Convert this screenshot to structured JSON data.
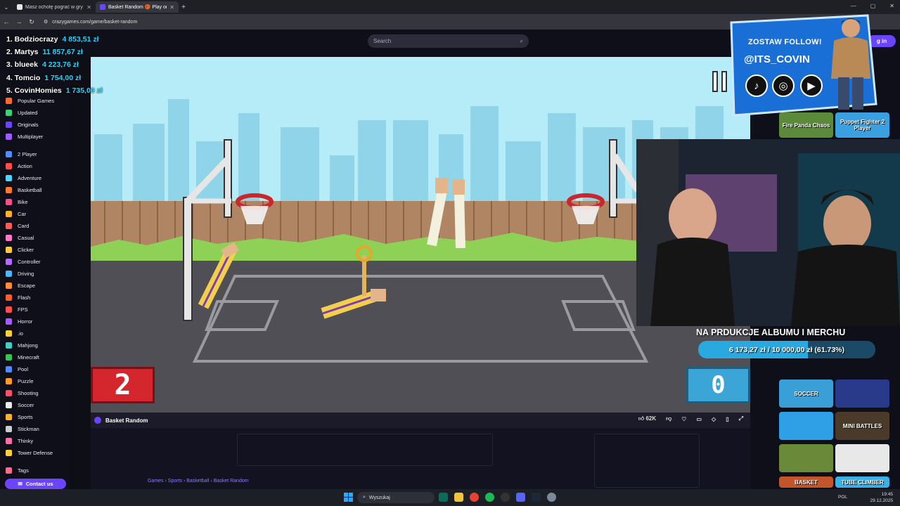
{
  "browser": {
    "tabs": [
      {
        "title": "Masz ochotę pograć w gry Mu..."
      },
      {
        "title": "Basket Random 🏀 Play on..."
      }
    ],
    "url": "crazygames.com/game/basket-random"
  },
  "site": {
    "search_placeholder": "Search",
    "login_label": "g in"
  },
  "leaderboard": [
    {
      "name": "1. Bodziocrazy",
      "amount": "4 853,51 zł"
    },
    {
      "name": "2. Martys",
      "amount": "11 857,67 zł"
    },
    {
      "name": "3. blueek",
      "amount": "4 223,76 zł"
    },
    {
      "name": "4. Tomcio",
      "amount": "1 754,00 zł"
    },
    {
      "name": "5. CovinHomies",
      "amount": "1 735,00 zł"
    }
  ],
  "sidebar": {
    "items": [
      {
        "label": "Popular Games",
        "color": "#ff6a2b"
      },
      {
        "label": "Updated",
        "color": "#3ad17a"
      },
      {
        "label": "Originals",
        "color": "#6b44ff"
      },
      {
        "label": "Multiplayer",
        "color": "#a15cff"
      },
      {
        "label": "2 Player",
        "color": "#4f8cff"
      },
      {
        "label": "Action",
        "color": "#ff4d4d"
      },
      {
        "label": "Adventure",
        "color": "#4fd3ff"
      },
      {
        "label": "Basketball",
        "color": "#ff7b2b"
      },
      {
        "label": "Bike",
        "color": "#ff4d88"
      },
      {
        "label": "Car",
        "color": "#ffb02b"
      },
      {
        "label": "Card",
        "color": "#ff5a5a"
      },
      {
        "label": "Casual",
        "color": "#ff79c6"
      },
      {
        "label": "Clicker",
        "color": "#ffc93a"
      },
      {
        "label": "Controller",
        "color": "#b46bff"
      },
      {
        "label": "Driving",
        "color": "#4fb4ff"
      },
      {
        "label": "Escape",
        "color": "#ff8a3a"
      },
      {
        "label": "Flash",
        "color": "#ff5c2b"
      },
      {
        "label": "FPS",
        "color": "#ff4d4d"
      },
      {
        "label": "Horror",
        "color": "#a85cff"
      },
      {
        "label": ".io",
        "color": "#ffcf3a"
      },
      {
        "label": "Mahjong",
        "color": "#3ad1c6"
      },
      {
        "label": "Minecraft",
        "color": "#3ac15a"
      },
      {
        "label": "Pool",
        "color": "#4f8cff"
      },
      {
        "label": "Puzzle",
        "color": "#ff9a2b"
      },
      {
        "label": "Shooting",
        "color": "#ff4d6a"
      },
      {
        "label": "Soccer",
        "color": "#eaeaea"
      },
      {
        "label": "Sports",
        "color": "#ffb02b"
      },
      {
        "label": "Stickman",
        "color": "#cccccc"
      },
      {
        "label": "Thinky",
        "color": "#ff6aa8"
      },
      {
        "label": "Tower Defense",
        "color": "#ffcf3a"
      },
      {
        "label": "Tags",
        "color": "#ff6a8a"
      }
    ],
    "contact_label": "Contact us"
  },
  "game": {
    "title": "Basket Random",
    "score_left": "2",
    "score_right": "0",
    "likes": "62K",
    "breadcrumbs": "Games › Sports › Basketball › Basket Random"
  },
  "right_thumbs": [
    {
      "label": "Fire Panda Chaos",
      "color": "#5b8a3a"
    },
    {
      "label": "Puppet Fighter 2 Player",
      "color": "#3aa0e0"
    },
    {
      "label": "",
      "color": "#2c3a2a"
    },
    {
      "label": "",
      "color": "#3a4a6a"
    },
    {
      "label": "SOCCER",
      "color": "#3a9fd6"
    },
    {
      "label": "",
      "color": "#2a3a8a"
    },
    {
      "label": "",
      "color": "#2fa0e6"
    },
    {
      "label": "MINI BATTLES",
      "color": "#4a3a2a"
    },
    {
      "label": "",
      "color": "#6a8a3a"
    },
    {
      "label": "",
      "color": "#e8e8e8"
    },
    {
      "label": "BASKET",
      "color": "#c2562a"
    },
    {
      "label": "TUBE CLIMBER",
      "color": "#3ab0e6"
    }
  ],
  "stream": {
    "follow_text": "ZOSTAW FOLLOW!",
    "handle": "@ITS_COVIN",
    "goal_title": "NA PRDUKCJE ALBUMU I MERCHU",
    "goal_text": "6 173,27 zł / 10 000,00 zł (61.73%)",
    "goal_progress": 0.6173
  },
  "taskbar": {
    "search_placeholder": "Wyszukaj",
    "lang": "POL",
    "time": "19:45",
    "date": "29.12.2025"
  }
}
